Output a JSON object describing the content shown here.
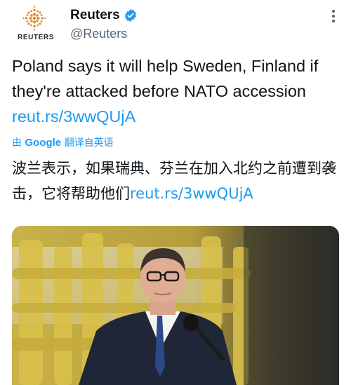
{
  "account": {
    "display_name": "Reuters",
    "handle": "@Reuters",
    "avatar_wordmark": "REUTERS",
    "verified": true,
    "avatar_icon": "reuters-logo-dots",
    "verified_icon": "verified-badge-icon",
    "more_icon": "more-vertical-icon"
  },
  "tweet": {
    "text_en": "Poland says it will help Sweden, Finland if they're attacked before NATO accession ",
    "link": "reut.rs/3wwQUjA",
    "translation": {
      "prefix": "由 ",
      "provider": "Google",
      "suffix": " 翻译自英语"
    },
    "text_zh": "波兰表示，如果瑞典、芬兰在加入北约之前遭到袭击，它将帮助他们",
    "link_zh": "reut.rs/3wwQUjA"
  },
  "media": {
    "description_icon": "photo-man-in-suit-at-microphone"
  },
  "colors": {
    "link": "#1d9bf0",
    "text": "#0f1419",
    "secondary": "#536471",
    "brand": "#f08a1c"
  }
}
